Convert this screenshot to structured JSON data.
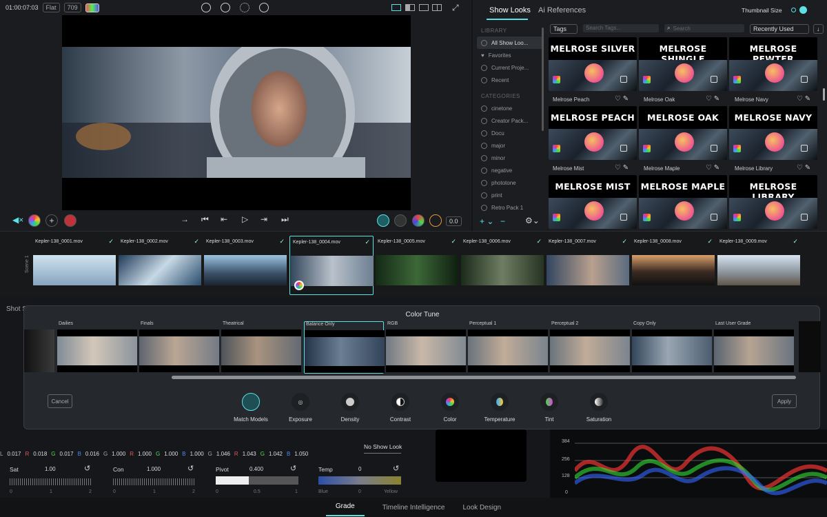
{
  "viewer": {
    "timecode": "01:00:07:03",
    "mode": "Flat",
    "colorspace": "709",
    "offset_value": "0.0"
  },
  "looks": {
    "tabs": [
      "Show Looks",
      "Ai References"
    ],
    "thumbnail_size_label": "Thumbnail Size",
    "tags_label": "Tags",
    "tags_placeholder": "Search Tags...",
    "search_placeholder": "Search",
    "sort": "Recently Used",
    "library_header": "LIBRARY",
    "library": [
      "All Show Loo...",
      "Favorites",
      "Current Proje...",
      "Recent"
    ],
    "categories_header": "CATEGORIES",
    "categories": [
      "cinetone",
      "Creator Pack...",
      "Docu",
      "major",
      "minor",
      "negative",
      "phototone",
      "print",
      "Retro Pack 1"
    ],
    "cards": [
      {
        "title": "MELROSE SILVER",
        "label": "Melrose Peach"
      },
      {
        "title": "MELROSE SHINGLE",
        "label": "Melrose Oak"
      },
      {
        "title": "MELROSE PEWTER",
        "label": "Melrose Navy"
      },
      {
        "title": "MELROSE PEACH",
        "label": "Melrose Mist"
      },
      {
        "title": "MELROSE OAK",
        "label": "Melrose Maple"
      },
      {
        "title": "MELROSE NAVY",
        "label": "Melrose Library"
      },
      {
        "title": "MELROSE MIST",
        "label": ""
      },
      {
        "title": "MELROSE MAPLE",
        "label": ""
      },
      {
        "title": "MELROSE LIBRARY",
        "label": ""
      }
    ]
  },
  "timeline": {
    "scene_label": "Scene 1",
    "clips": [
      "Kepler-138_0001.mov",
      "Kepler-138_0002.mov",
      "Kepler-138_0003.mov",
      "Kepler-138_0004.mov",
      "Kepler-138_0005.mov",
      "Kepler-138_0006.mov",
      "Kepler-138_0007.mov",
      "Kepler-138_0008.mov",
      "Kepler-138_0009.mov"
    ],
    "selected_index": 3
  },
  "color_tune": {
    "title": "Color Tune",
    "presets": [
      "Dailies",
      "Finals",
      "Theatrical",
      "Balance Only",
      "RGB",
      "Perceptual 1",
      "Perceptual 2",
      "Copy Only",
      "Last User Grade"
    ],
    "selected_index": 3,
    "cancel": "Cancel",
    "apply": "Apply",
    "tools": [
      "Match Models",
      "Exposure",
      "Density",
      "Contrast",
      "Color",
      "Temperature",
      "Tint",
      "Saturation"
    ]
  },
  "grade": {
    "shot_label": "Shot S",
    "no_show_look": "No Show Look",
    "rgb_rows": [
      {
        "L": "0.017",
        "R": "0.018",
        "G": "0.017",
        "B": "0.016"
      },
      {
        "G": "1.000",
        "R": "1.000",
        "G2": "1.000",
        "B": "1.000"
      },
      {
        "G": "1.046",
        "R": "1.043",
        "G2": "1.042",
        "B": "1.050"
      }
    ],
    "sliders": [
      {
        "label": "Sat",
        "value": "1.00",
        "ticks": [
          "0",
          "1",
          "2"
        ]
      },
      {
        "label": "Con",
        "value": "1.000",
        "ticks": [
          "0",
          "1",
          "2"
        ]
      },
      {
        "label": "Pivot",
        "value": "0.400",
        "ticks": [
          "0",
          "0.5",
          "1"
        ]
      },
      {
        "label": "Temp",
        "value": "0",
        "ticks": [
          "Blue",
          "0",
          "Yellow"
        ]
      }
    ],
    "scope_ticks": [
      "384",
      "256",
      "128",
      "0"
    ]
  },
  "nav": [
    "Grade",
    "Timeline Intelligence",
    "Look Design"
  ]
}
